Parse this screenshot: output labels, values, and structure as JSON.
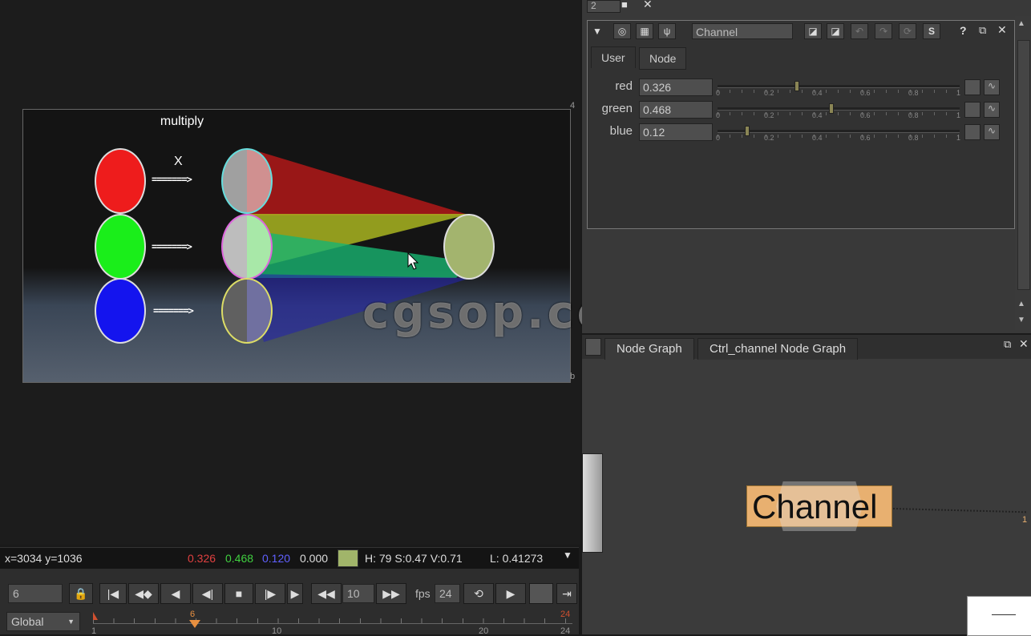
{
  "viewer": {
    "frame_title": "multiply",
    "x_label": "X",
    "arrow": "=======>",
    "watermark": "cgsop.com",
    "frame_number_top": "4",
    "frame_number_bottom": "b",
    "colors": {
      "red": "#ee1c1c",
      "green": "#1aee1a",
      "blue": "#1414ee",
      "result": "#a3b46e"
    }
  },
  "infobar": {
    "coords": "x=3034 y=1036",
    "r": "0.326",
    "g": "0.468",
    "b": "0.120",
    "a": "0.000",
    "swatch": "#a1b56a",
    "hsv": "H: 79 S:0.47 V:0.71",
    "lum": "L: 0.41273"
  },
  "timeline": {
    "current_frame": "6",
    "skip_value": "10",
    "fps_label": "fps",
    "fps": "24",
    "scope": "Global",
    "start": "1",
    "end": "24",
    "marker": "6",
    "ticks": [
      "1",
      "10",
      "20",
      "24"
    ]
  },
  "topbar": {
    "value": "2"
  },
  "properties": {
    "node_name": "Channel",
    "tabs": [
      "User",
      "Node"
    ],
    "active_tab": "User",
    "help": "?",
    "params": [
      {
        "label": "red",
        "value": "0.326",
        "fraction": 0.326
      },
      {
        "label": "green",
        "value": "0.468",
        "fraction": 0.468
      },
      {
        "label": "blue",
        "value": "0.12",
        "fraction": 0.12
      }
    ],
    "slider_ticks": [
      "0",
      "0.2",
      "0.4",
      "0.6",
      "0.8",
      "1"
    ]
  },
  "nodegraph": {
    "tabs": [
      "Node Graph",
      "Ctrl_channel Node Graph"
    ],
    "node_label": "Channel",
    "edge_end": "1"
  }
}
